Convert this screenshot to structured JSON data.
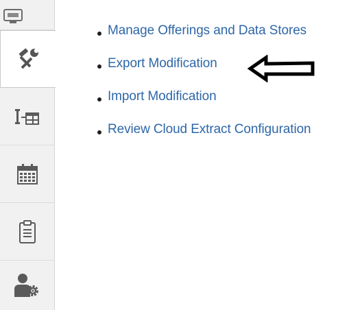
{
  "sidebar": {
    "items": [
      {
        "icon": "monitor-icon",
        "active": false
      },
      {
        "icon": "tools-icon",
        "active": true
      },
      {
        "icon": "data-structure-icon",
        "active": false
      },
      {
        "icon": "calendar-icon",
        "active": false
      },
      {
        "icon": "clipboard-icon",
        "active": false
      },
      {
        "icon": "user-settings-icon",
        "active": false
      }
    ]
  },
  "main": {
    "links": [
      {
        "label": "Manage Offerings and Data Stores"
      },
      {
        "label": "Export Modification"
      },
      {
        "label": "Import Modification"
      },
      {
        "label": "Review Cloud Extract Configuration"
      }
    ],
    "annotation": {
      "icon": "left-arrow-icon"
    }
  },
  "colors": {
    "link": "#2e67a8",
    "rail_bg": "#f1f1f1",
    "icon": "#5a5a5a"
  }
}
